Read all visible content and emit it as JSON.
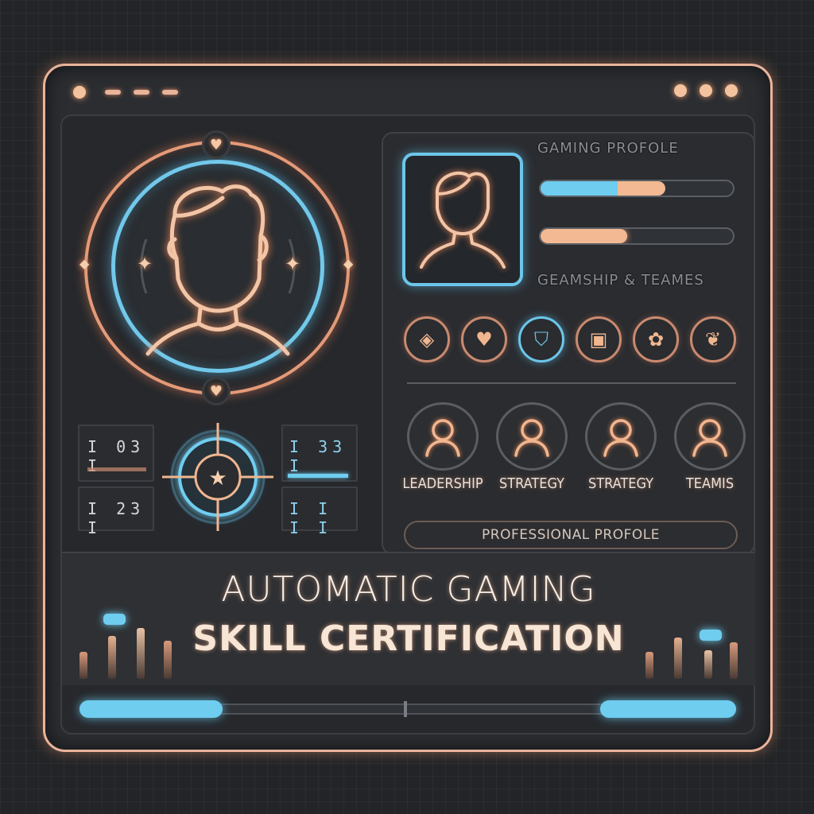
{
  "window": {
    "controls_left": [
      "dot",
      "dash",
      "dash",
      "dash"
    ],
    "controls_right": [
      "dot",
      "dot",
      "dot"
    ]
  },
  "left_panel": {
    "mini_stats": [
      {
        "text": "I 03 I"
      },
      {
        "text": "I 33 I"
      },
      {
        "text": "I 23 I"
      },
      {
        "text": "I I I I"
      }
    ]
  },
  "right_panel": {
    "heading": "GAMING PROFOLE",
    "progress_bars": [
      {
        "blue": 0.4,
        "orange": 0.25
      },
      {
        "blue": 0.0,
        "orange": 0.45
      }
    ],
    "subheading": "GEAMSHIP & TEAMES",
    "badges": [
      {
        "icon": "compass-icon",
        "glyph": "◈",
        "style": "orange"
      },
      {
        "icon": "heart-badge-icon",
        "glyph": "♥",
        "style": "orange"
      },
      {
        "icon": "shield-icon",
        "glyph": "⛉",
        "style": "blue"
      },
      {
        "icon": "crest-icon",
        "glyph": "▣",
        "style": "orange"
      },
      {
        "icon": "leaf-icon",
        "glyph": "✿",
        "style": "orange"
      },
      {
        "icon": "lotus-icon",
        "glyph": "❦",
        "style": "orange"
      }
    ],
    "members": [
      {
        "label": "LEADERSHIP"
      },
      {
        "label": "STRATEGY"
      },
      {
        "label": "STRATEGY"
      },
      {
        "label": "TEAMIS"
      }
    ],
    "profile_button": "PROFESSIONAL PROFOLE"
  },
  "title": {
    "line1": "AUTOMATIC GAMING",
    "line2": "SKILL CERTIFICATION"
  },
  "bottom_progress": {
    "left_fill": 0.44,
    "right_fill": 0.42
  },
  "colors": {
    "accent_orange": "#e9a07e",
    "accent_blue": "#6fcdf0",
    "background": "#222427"
  }
}
